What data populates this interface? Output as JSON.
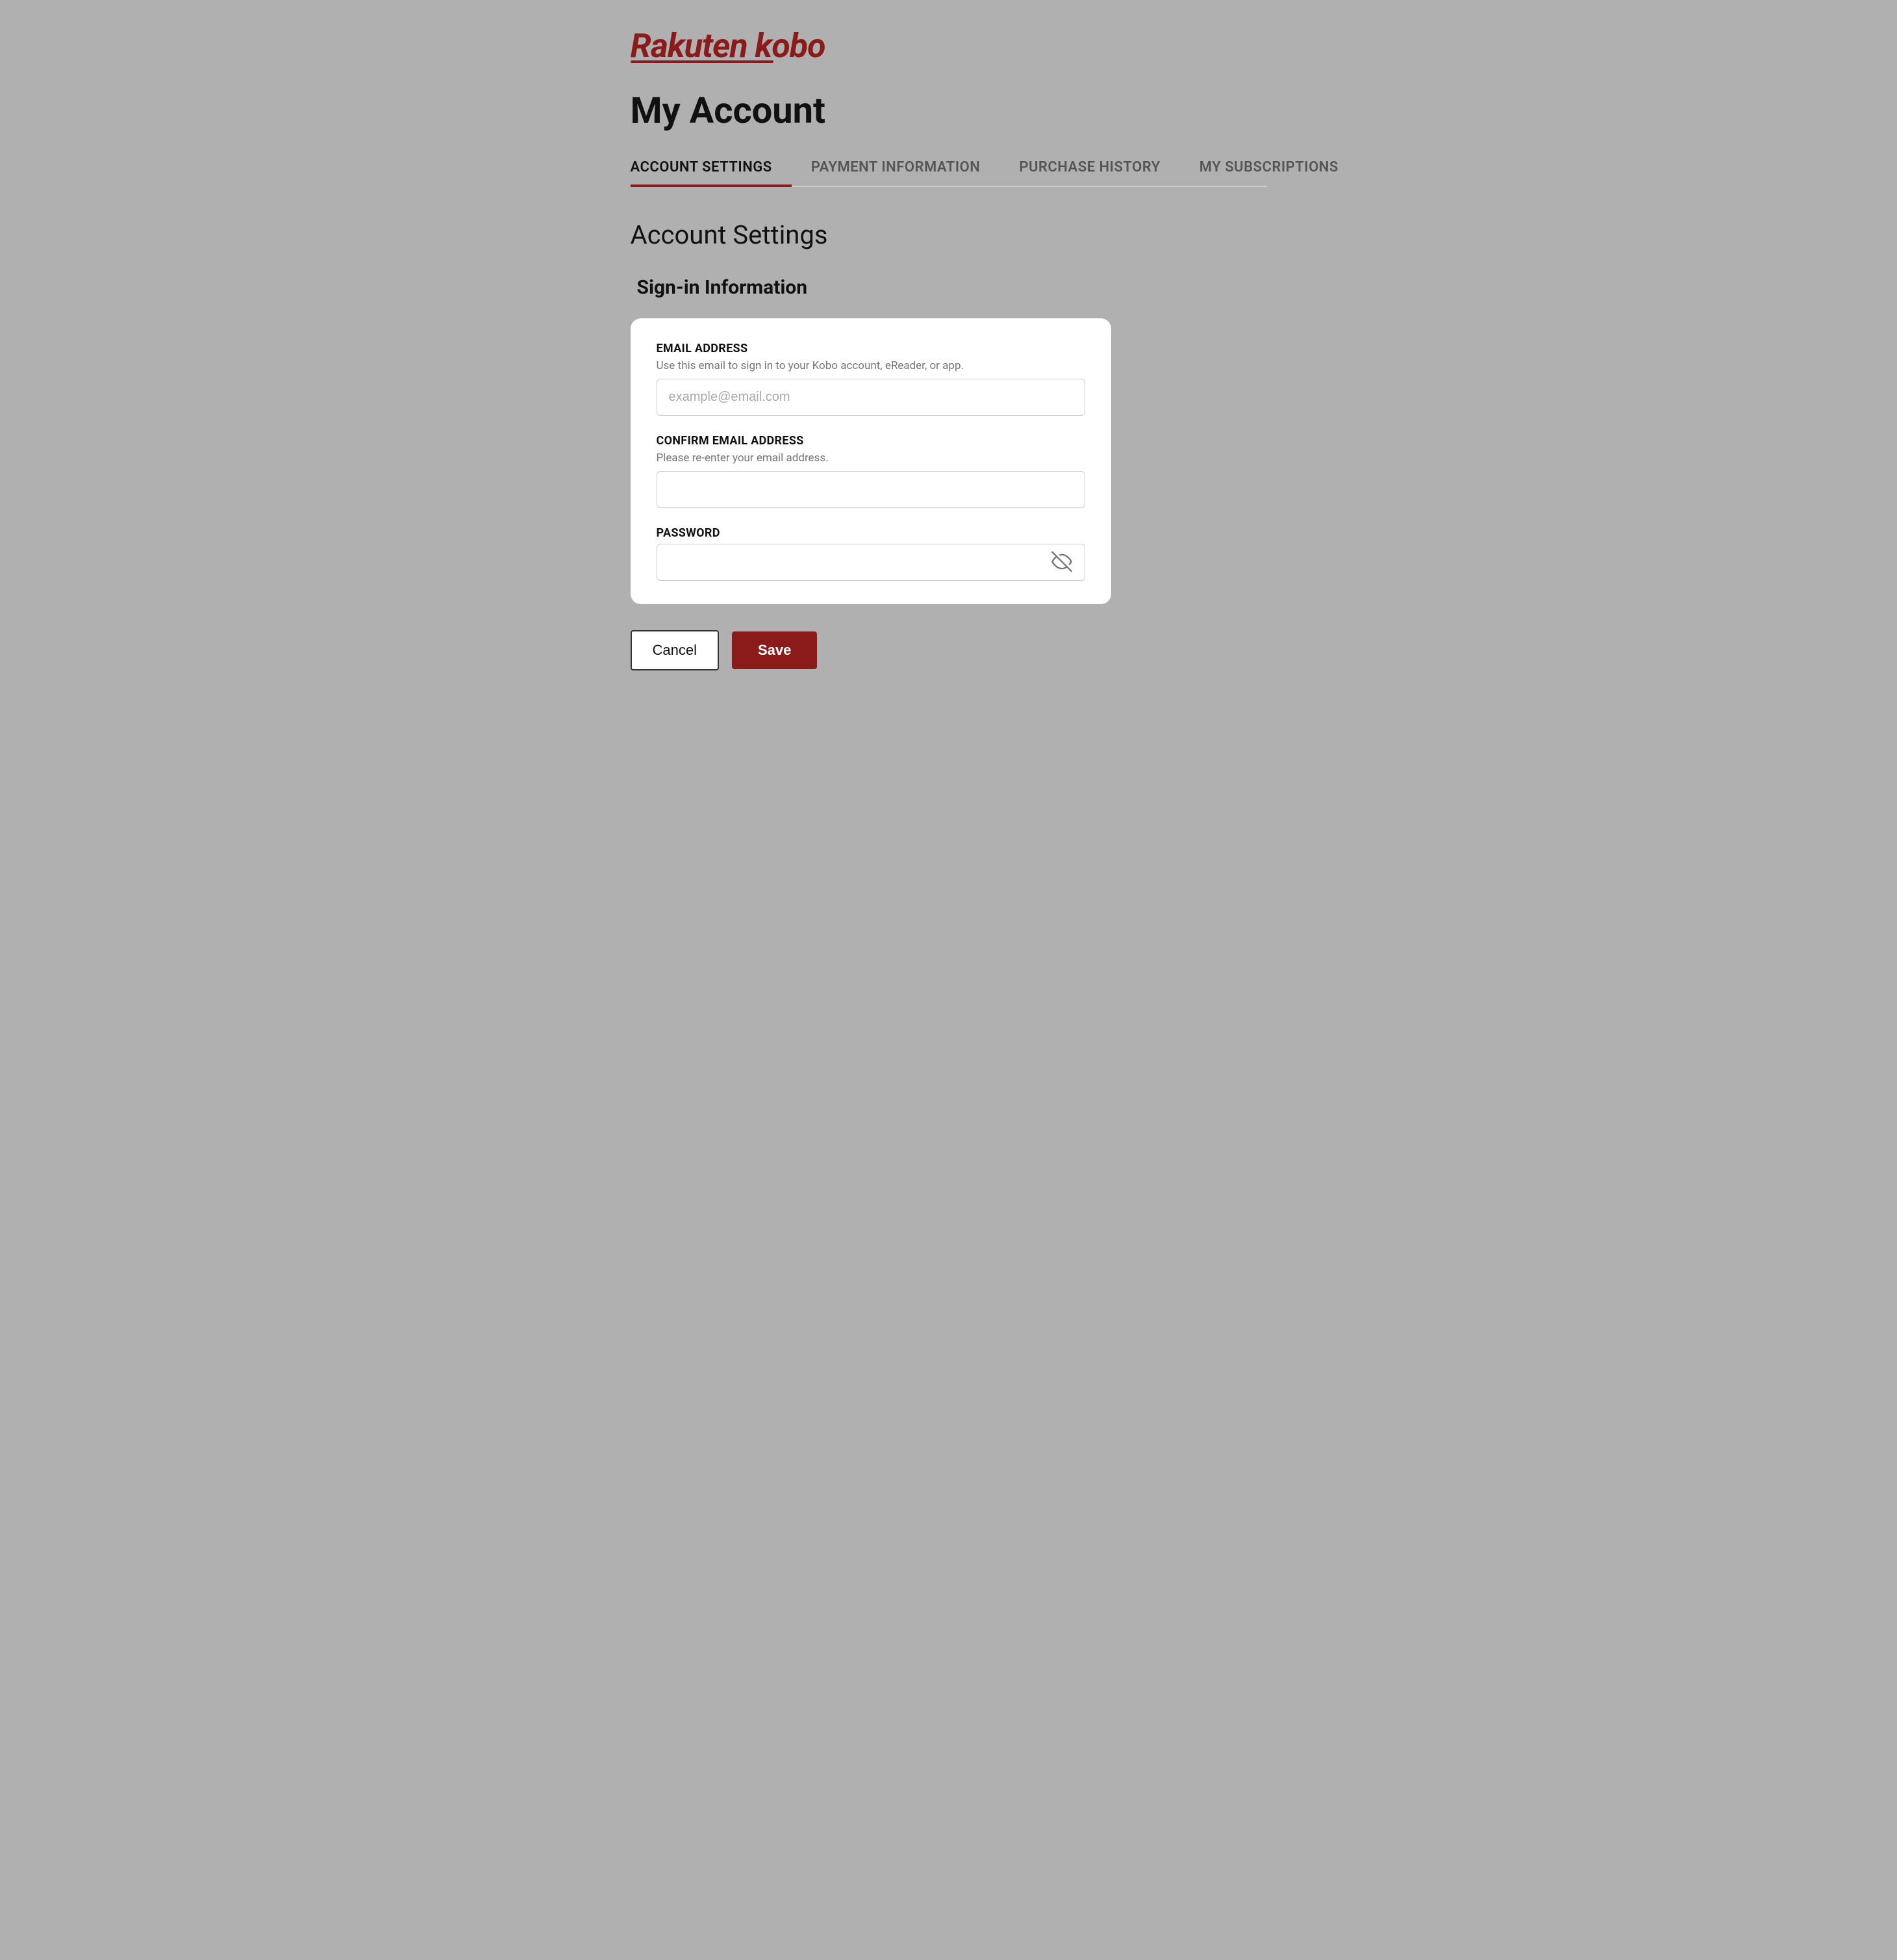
{
  "logo": {
    "text": "Rakuten kobo",
    "rakuten": "Rakuten",
    "kobo": "kobo"
  },
  "page": {
    "title": "My Account"
  },
  "tabs": {
    "items": [
      {
        "id": "account-settings",
        "label": "ACCOUNT SETTINGS",
        "active": true
      },
      {
        "id": "payment-information",
        "label": "PAYMENT INFORMATION",
        "active": false
      },
      {
        "id": "purchase-history",
        "label": "PURCHASE HISTORY",
        "active": false
      },
      {
        "id": "my-subscriptions",
        "label": "MY SUBSCRIPTIONS",
        "active": false
      }
    ]
  },
  "section": {
    "title": "Account Settings",
    "subsection": "Sign-in Information"
  },
  "form": {
    "email_label": "EMAIL ADDRESS",
    "email_description": "Use this email to sign in to your Kobo account, eReader, or app.",
    "email_placeholder": "example@email.com",
    "email_value": "",
    "confirm_email_label": "CONFIRM EMAIL ADDRESS",
    "confirm_email_description": "Please re-enter your email address.",
    "confirm_email_placeholder": "",
    "confirm_email_value": "",
    "password_label": "PASSWORD",
    "password_placeholder": "",
    "password_value": ""
  },
  "buttons": {
    "cancel_label": "Cancel",
    "save_label": "Save"
  }
}
